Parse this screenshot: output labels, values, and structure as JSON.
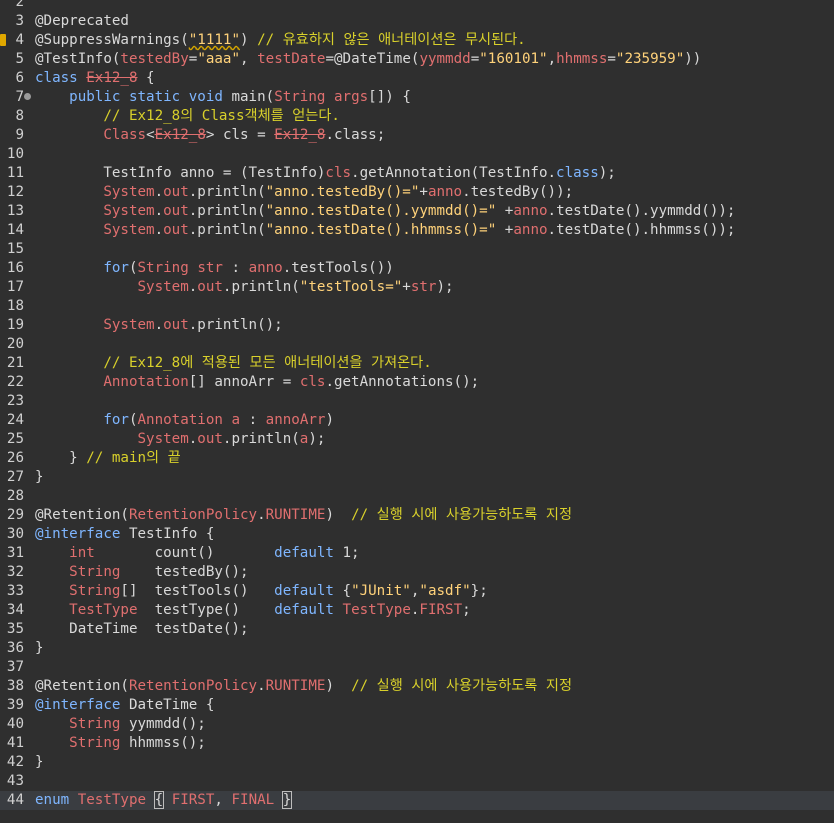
{
  "editor": {
    "lines": [
      {
        "n": "2",
        "tokens": []
      },
      {
        "n": "3",
        "tokens": [
          [
            "ann",
            "@Deprecated"
          ]
        ]
      },
      {
        "n": "4",
        "warn": true,
        "tokens": [
          [
            "ann",
            "@SuppressWarnings("
          ],
          [
            "str squiggle",
            "\"1111\""
          ],
          [
            "ann",
            ") "
          ],
          [
            "comment",
            "// 유효하지 않은 애너테이션은 무시된다."
          ]
        ]
      },
      {
        "n": "5",
        "tokens": [
          [
            "ann",
            "@TestInfo("
          ],
          [
            "param",
            "testedBy"
          ],
          [
            "ann",
            "="
          ],
          [
            "str",
            "\"aaa\""
          ],
          [
            "ann",
            ", "
          ],
          [
            "param",
            "testDate"
          ],
          [
            "ann",
            "=@DateTime("
          ],
          [
            "param",
            "yymmdd"
          ],
          [
            "ann",
            "="
          ],
          [
            "str",
            "\"160101\""
          ],
          [
            "ann",
            ","
          ],
          [
            "param",
            "hhmmss"
          ],
          [
            "ann",
            "="
          ],
          [
            "str",
            "\"235959\""
          ],
          [
            "ann",
            "))"
          ]
        ]
      },
      {
        "n": "6",
        "tokens": [
          [
            "kw",
            "class "
          ],
          [
            "strike",
            "Ex12_8"
          ],
          [
            "local",
            " {"
          ]
        ]
      },
      {
        "n": "7",
        "fold": true,
        "tokens": [
          [
            "local",
            "    "
          ],
          [
            "kw",
            "public static void "
          ],
          [
            "method",
            "main("
          ],
          [
            "type",
            "String "
          ],
          [
            "param",
            "args"
          ],
          [
            "local",
            "[]) {"
          ]
        ]
      },
      {
        "n": "8",
        "tokens": [
          [
            "local",
            "        "
          ],
          [
            "comment",
            "// Ex12_8의 Class객체를 얻는다."
          ]
        ]
      },
      {
        "n": "9",
        "tokens": [
          [
            "local",
            "        "
          ],
          [
            "type",
            "Class"
          ],
          [
            "local",
            "<"
          ],
          [
            "strike",
            "Ex12_8"
          ],
          [
            "local",
            "> cls = "
          ],
          [
            "strike",
            "Ex12_8"
          ],
          [
            "local",
            ".class;"
          ]
        ]
      },
      {
        "n": "10",
        "tokens": []
      },
      {
        "n": "11",
        "tokens": [
          [
            "local",
            "        TestInfo anno = (TestInfo)"
          ],
          [
            "param",
            "cls"
          ],
          [
            "local",
            ".getAnnotation(TestInfo."
          ],
          [
            "kw",
            "class"
          ],
          [
            "local",
            ");"
          ]
        ]
      },
      {
        "n": "12",
        "tokens": [
          [
            "local",
            "        "
          ],
          [
            "type",
            "System"
          ],
          [
            "local",
            "."
          ],
          [
            "param",
            "out"
          ],
          [
            "local",
            ".println("
          ],
          [
            "str",
            "\"anno.testedBy()=\""
          ],
          [
            "local",
            "+"
          ],
          [
            "param",
            "anno"
          ],
          [
            "local",
            ".testedBy());"
          ]
        ]
      },
      {
        "n": "13",
        "tokens": [
          [
            "local",
            "        "
          ],
          [
            "type",
            "System"
          ],
          [
            "local",
            "."
          ],
          [
            "param",
            "out"
          ],
          [
            "local",
            ".println("
          ],
          [
            "str",
            "\"anno.testDate().yymmdd()=\""
          ],
          [
            "local",
            " +"
          ],
          [
            "param",
            "anno"
          ],
          [
            "local",
            ".testDate().yymmdd());"
          ]
        ]
      },
      {
        "n": "14",
        "tokens": [
          [
            "local",
            "        "
          ],
          [
            "type",
            "System"
          ],
          [
            "local",
            "."
          ],
          [
            "param",
            "out"
          ],
          [
            "local",
            ".println("
          ],
          [
            "str",
            "\"anno.testDate().hhmmss()=\""
          ],
          [
            "local",
            " +"
          ],
          [
            "param",
            "anno"
          ],
          [
            "local",
            ".testDate().hhmmss());"
          ]
        ]
      },
      {
        "n": "15",
        "tokens": []
      },
      {
        "n": "16",
        "tokens": [
          [
            "local",
            "        "
          ],
          [
            "kw",
            "for"
          ],
          [
            "local",
            "("
          ],
          [
            "type",
            "String "
          ],
          [
            "param",
            "str"
          ],
          [
            "local",
            " : "
          ],
          [
            "param",
            "anno"
          ],
          [
            "local",
            ".testTools())"
          ]
        ]
      },
      {
        "n": "17",
        "tokens": [
          [
            "local",
            "            "
          ],
          [
            "type",
            "System"
          ],
          [
            "local",
            "."
          ],
          [
            "param",
            "out"
          ],
          [
            "local",
            ".println("
          ],
          [
            "str",
            "\"testTools=\""
          ],
          [
            "local",
            "+"
          ],
          [
            "param",
            "str"
          ],
          [
            "local",
            ");"
          ]
        ]
      },
      {
        "n": "18",
        "tokens": []
      },
      {
        "n": "19",
        "tokens": [
          [
            "local",
            "        "
          ],
          [
            "type",
            "System"
          ],
          [
            "local",
            "."
          ],
          [
            "param",
            "out"
          ],
          [
            "local",
            ".println();"
          ]
        ]
      },
      {
        "n": "20",
        "tokens": []
      },
      {
        "n": "21",
        "tokens": [
          [
            "local",
            "        "
          ],
          [
            "comment",
            "// Ex12_8에 적용된 모든 애너테이션을 가져온다."
          ]
        ]
      },
      {
        "n": "22",
        "tokens": [
          [
            "local",
            "        "
          ],
          [
            "type",
            "Annotation"
          ],
          [
            "local",
            "[] annoArr = "
          ],
          [
            "param",
            "cls"
          ],
          [
            "local",
            ".getAnnotations();"
          ]
        ]
      },
      {
        "n": "23",
        "tokens": []
      },
      {
        "n": "24",
        "tokens": [
          [
            "local",
            "        "
          ],
          [
            "kw",
            "for"
          ],
          [
            "local",
            "("
          ],
          [
            "type",
            "Annotation "
          ],
          [
            "param",
            "a"
          ],
          [
            "local",
            " : "
          ],
          [
            "param",
            "annoArr"
          ],
          [
            "local",
            ")"
          ]
        ]
      },
      {
        "n": "25",
        "tokens": [
          [
            "local",
            "            "
          ],
          [
            "type",
            "System"
          ],
          [
            "local",
            "."
          ],
          [
            "param",
            "out"
          ],
          [
            "local",
            ".println("
          ],
          [
            "param",
            "a"
          ],
          [
            "local",
            ");"
          ]
        ]
      },
      {
        "n": "26",
        "tokens": [
          [
            "local",
            "    } "
          ],
          [
            "comment",
            "// main의 끝"
          ]
        ]
      },
      {
        "n": "27",
        "tokens": [
          [
            "local",
            "}"
          ]
        ]
      },
      {
        "n": "28",
        "tokens": []
      },
      {
        "n": "29",
        "tokens": [
          [
            "ann",
            "@Retention("
          ],
          [
            "type",
            "RetentionPolicy"
          ],
          [
            "ann",
            "."
          ],
          [
            "param",
            "RUNTIME"
          ],
          [
            "ann",
            ")  "
          ],
          [
            "comment",
            "// 실행 시에 사용가능하도록 지정"
          ]
        ]
      },
      {
        "n": "30",
        "tokens": [
          [
            "kw",
            "@interface "
          ],
          [
            "local",
            "TestInfo {"
          ]
        ]
      },
      {
        "n": "31",
        "tokens": [
          [
            "local",
            "    "
          ],
          [
            "type",
            "int"
          ],
          [
            "local",
            "       count()       "
          ],
          [
            "kw",
            "default "
          ],
          [
            "local",
            "1;"
          ]
        ]
      },
      {
        "n": "32",
        "tokens": [
          [
            "local",
            "    "
          ],
          [
            "type",
            "String"
          ],
          [
            "local",
            "    testedBy();"
          ]
        ]
      },
      {
        "n": "33",
        "tokens": [
          [
            "local",
            "    "
          ],
          [
            "type",
            "String"
          ],
          [
            "local",
            "[]  testTools()   "
          ],
          [
            "kw",
            "default "
          ],
          [
            "local",
            "{"
          ],
          [
            "str",
            "\"JUnit\""
          ],
          [
            "local",
            ","
          ],
          [
            "str",
            "\"asdf\""
          ],
          [
            "local",
            "};"
          ]
        ]
      },
      {
        "n": "34",
        "tokens": [
          [
            "local",
            "    "
          ],
          [
            "type",
            "TestType"
          ],
          [
            "local",
            "  testType()    "
          ],
          [
            "kw",
            "default "
          ],
          [
            "type",
            "TestType"
          ],
          [
            "local",
            "."
          ],
          [
            "param",
            "FIRST"
          ],
          [
            "local",
            ";"
          ]
        ]
      },
      {
        "n": "35",
        "tokens": [
          [
            "local",
            "    DateTime  testDate();"
          ]
        ]
      },
      {
        "n": "36",
        "tokens": [
          [
            "local",
            "}"
          ]
        ]
      },
      {
        "n": "37",
        "tokens": []
      },
      {
        "n": "38",
        "tokens": [
          [
            "ann",
            "@Retention("
          ],
          [
            "type",
            "RetentionPolicy"
          ],
          [
            "ann",
            "."
          ],
          [
            "param",
            "RUNTIME"
          ],
          [
            "ann",
            ")  "
          ],
          [
            "comment",
            "// 실행 시에 사용가능하도록 지정"
          ]
        ]
      },
      {
        "n": "39",
        "tokens": [
          [
            "kw",
            "@interface "
          ],
          [
            "local",
            "DateTime {"
          ]
        ]
      },
      {
        "n": "40",
        "tokens": [
          [
            "local",
            "    "
          ],
          [
            "type",
            "String "
          ],
          [
            "local",
            "yymmdd();"
          ]
        ]
      },
      {
        "n": "41",
        "tokens": [
          [
            "local",
            "    "
          ],
          [
            "type",
            "String "
          ],
          [
            "local",
            "hhmmss();"
          ]
        ]
      },
      {
        "n": "42",
        "tokens": [
          [
            "local",
            "}"
          ]
        ]
      },
      {
        "n": "43",
        "tokens": []
      },
      {
        "n": "44",
        "current": true,
        "tokens": [
          [
            "kw",
            "enum "
          ],
          [
            "type",
            "TestType "
          ],
          [
            "local bracket-box",
            "{"
          ],
          [
            "local",
            " "
          ],
          [
            "param",
            "FIRST"
          ],
          [
            "local",
            ", "
          ],
          [
            "param",
            "FINAL"
          ],
          [
            "local",
            " "
          ],
          [
            "local bracket-box",
            "}"
          ]
        ]
      }
    ]
  }
}
